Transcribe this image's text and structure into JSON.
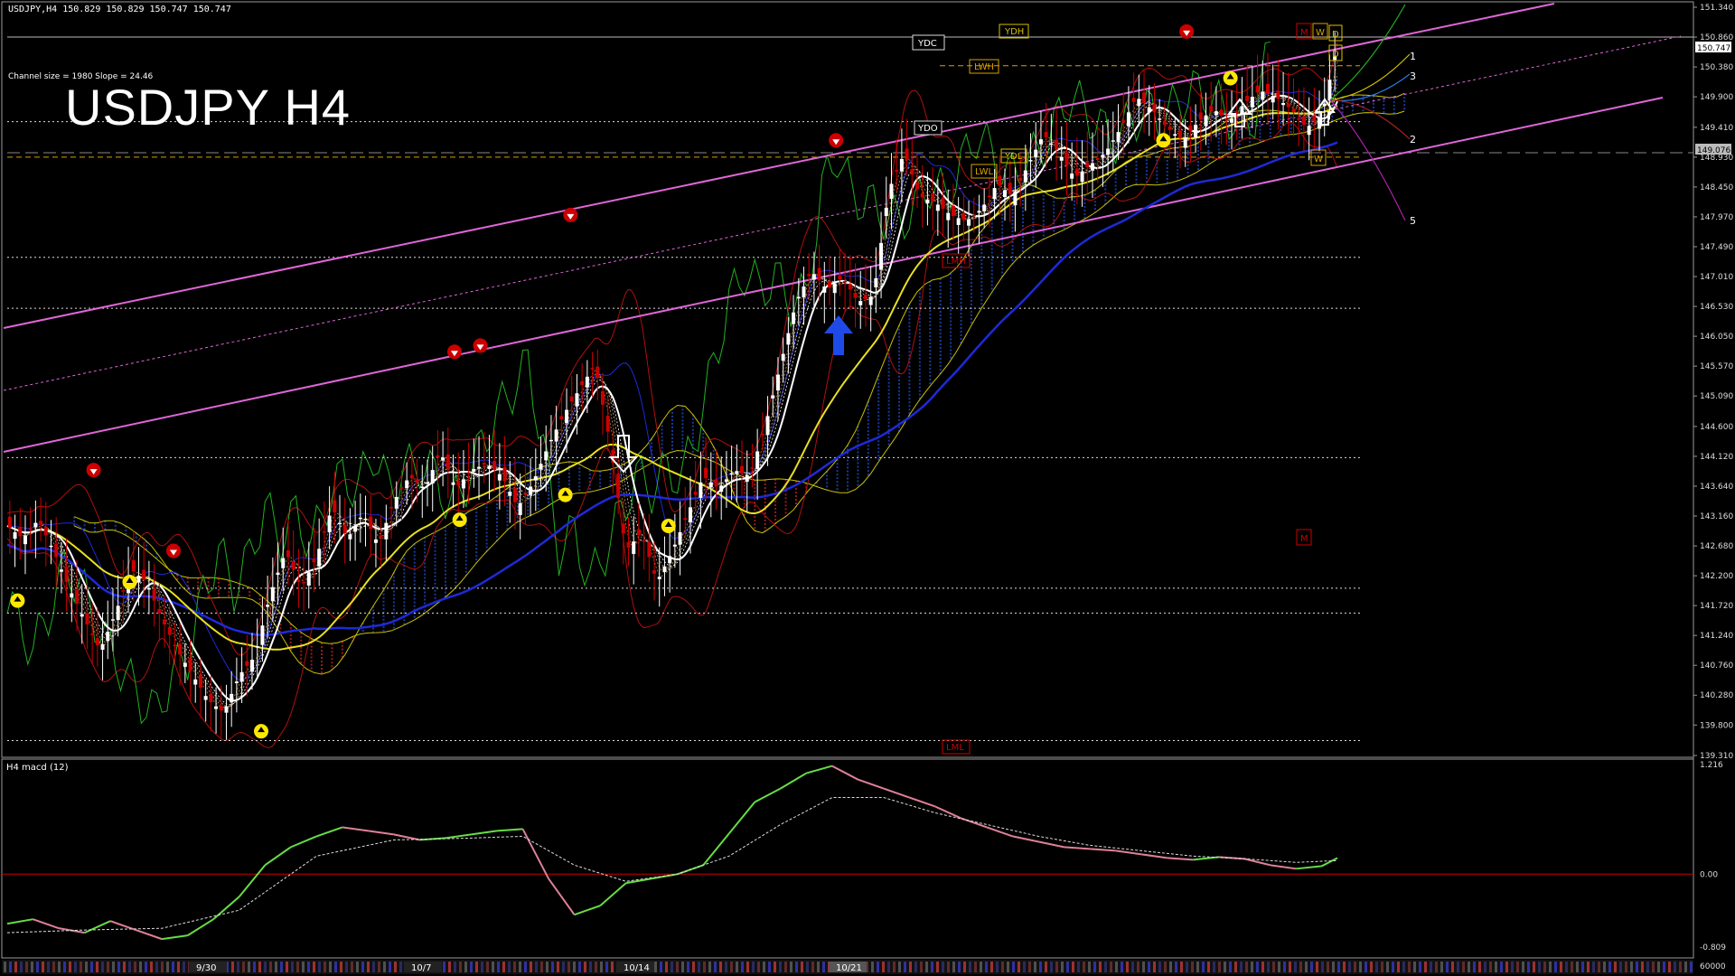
{
  "header": {
    "symbol_line": "USDJPY,H4  150.829 150.829 150.747 150.747",
    "channel_info": "Channel size = 1980 Slope = 24.46",
    "big_title": "USDJPY H4"
  },
  "macd_header": "H4  macd (12)",
  "colors": {
    "background": "#000000",
    "bull_candle": "#ffffff",
    "bear_candle": "#cc0000",
    "channel": "#e066d8",
    "ma_white": "#ffffff",
    "ma_yellow": "#e8e020",
    "ma_blue": "#1e2ad8",
    "bollinger": "#b01010",
    "chikou": "#22b022",
    "cloud_bull": "#1a3a9a",
    "cloud_bear": "#9a1a1a",
    "macd_up": "#66dd44",
    "macd_down": "#e08098",
    "zero_line": "#cc0000"
  },
  "price_axis_labels": [
    "151.340",
    "150.860",
    "150.380",
    "149.900",
    "149.410",
    "148.930",
    "148.450",
    "147.970",
    "147.490",
    "147.010",
    "146.530",
    "146.050",
    "145.570",
    "145.090",
    "144.600",
    "144.120",
    "143.640",
    "143.160",
    "142.680",
    "142.200",
    "141.720",
    "141.240",
    "140.760",
    "140.280",
    "139.800",
    "139.310"
  ],
  "price_tags": {
    "current": "150.747",
    "ydc_value": "150.747",
    "ydo_value": "149.076"
  },
  "level_labels": {
    "ydh": "YDH",
    "ydc": "YDC",
    "lwh": "LWH",
    "ydo": "YDO",
    "ydl": "YDL",
    "lwl": "LWL",
    "lmh": "LMH",
    "lml": "LML",
    "m_top": "M",
    "w_top": "W",
    "d_top": "D",
    "d_second": "D",
    "w_low": "W",
    "m_mid": "M"
  },
  "projection_labels": [
    "1",
    "3",
    "2",
    "5"
  ],
  "macd_axis_labels": [
    "1.216",
    "0.00",
    "-0.809",
    "60000"
  ],
  "date_labels": [
    "9/30",
    "10/7",
    "10/14",
    "10/21"
  ],
  "chart_data": {
    "type": "line",
    "title": "USDJPY H4",
    "y_axis_range": [
      139.31,
      151.34
    ],
    "series": [
      {
        "name": "USDJPY",
        "type": "candlestick-approx-close",
        "points": [
          [
            0,
            143.0
          ],
          [
            6,
            142.8
          ],
          [
            12,
            143.1
          ],
          [
            18,
            142.6
          ],
          [
            24,
            142.0
          ],
          [
            30,
            141.5
          ],
          [
            36,
            141.0
          ],
          [
            42,
            141.6
          ],
          [
            48,
            142.3
          ],
          [
            54,
            142.1
          ],
          [
            60,
            141.5
          ],
          [
            66,
            141.0
          ],
          [
            72,
            140.6
          ],
          [
            78,
            140.2
          ],
          [
            84,
            140.0
          ],
          [
            90,
            140.6
          ],
          [
            96,
            140.9
          ],
          [
            102,
            141.9
          ],
          [
            108,
            142.6
          ],
          [
            114,
            142.0
          ],
          [
            120,
            142.5
          ],
          [
            126,
            143.3
          ],
          [
            132,
            142.8
          ],
          [
            138,
            143.2
          ],
          [
            144,
            142.7
          ],
          [
            150,
            143.4
          ],
          [
            156,
            143.8
          ],
          [
            162,
            143.6
          ],
          [
            168,
            144.2
          ],
          [
            174,
            143.6
          ],
          [
            180,
            143.9
          ],
          [
            186,
            144.0
          ],
          [
            192,
            143.8
          ],
          [
            198,
            143.3
          ],
          [
            204,
            143.7
          ],
          [
            210,
            144.3
          ],
          [
            216,
            144.8
          ],
          [
            222,
            145.2
          ],
          [
            228,
            145.6
          ],
          [
            234,
            144.3
          ],
          [
            240,
            142.6
          ],
          [
            246,
            142.9
          ],
          [
            252,
            142.1
          ],
          [
            258,
            142.6
          ],
          [
            264,
            143.2
          ],
          [
            270,
            143.8
          ],
          [
            276,
            143.6
          ],
          [
            282,
            143.9
          ],
          [
            288,
            143.8
          ],
          [
            294,
            144.6
          ],
          [
            300,
            145.6
          ],
          [
            306,
            146.6
          ],
          [
            312,
            147.1
          ],
          [
            318,
            146.8
          ],
          [
            324,
            147.0
          ],
          [
            330,
            146.6
          ],
          [
            336,
            146.7
          ],
          [
            342,
            148.4
          ],
          [
            348,
            149.0
          ],
          [
            354,
            148.3
          ],
          [
            360,
            148.2
          ],
          [
            366,
            148.0
          ],
          [
            372,
            147.9
          ],
          [
            378,
            148.1
          ],
          [
            384,
            148.5
          ],
          [
            390,
            148.3
          ],
          [
            396,
            148.8
          ],
          [
            402,
            149.3
          ],
          [
            408,
            149.0
          ],
          [
            414,
            148.6
          ],
          [
            420,
            148.8
          ],
          [
            426,
            149.0
          ],
          [
            432,
            149.4
          ],
          [
            438,
            149.9
          ],
          [
            444,
            149.7
          ],
          [
            450,
            149.4
          ],
          [
            456,
            149.2
          ],
          [
            462,
            149.5
          ],
          [
            468,
            149.7
          ],
          [
            474,
            149.5
          ],
          [
            480,
            149.8
          ],
          [
            486,
            150.0
          ],
          [
            492,
            149.9
          ],
          [
            498,
            149.7
          ],
          [
            504,
            149.4
          ],
          [
            510,
            149.6
          ],
          [
            516,
            150.75
          ]
        ]
      }
    ],
    "macd_range": [
      -0.809,
      1.216
    ],
    "macd": [
      [
        0,
        -0.55
      ],
      [
        10,
        -0.5
      ],
      [
        20,
        -0.6
      ],
      [
        30,
        -0.65
      ],
      [
        40,
        -0.52
      ],
      [
        50,
        -0.62
      ],
      [
        60,
        -0.72
      ],
      [
        70,
        -0.68
      ],
      [
        80,
        -0.5
      ],
      [
        90,
        -0.25
      ],
      [
        100,
        0.1
      ],
      [
        110,
        0.3
      ],
      [
        120,
        0.42
      ],
      [
        130,
        0.52
      ],
      [
        140,
        0.48
      ],
      [
        150,
        0.44
      ],
      [
        160,
        0.38
      ],
      [
        170,
        0.4
      ],
      [
        180,
        0.44
      ],
      [
        190,
        0.48
      ],
      [
        200,
        0.5
      ],
      [
        210,
        -0.05
      ],
      [
        220,
        -0.45
      ],
      [
        230,
        -0.35
      ],
      [
        240,
        -0.1
      ],
      [
        250,
        -0.05
      ],
      [
        260,
        0.0
      ],
      [
        270,
        0.1
      ],
      [
        280,
        0.45
      ],
      [
        290,
        0.8
      ],
      [
        300,
        0.95
      ],
      [
        310,
        1.12
      ],
      [
        320,
        1.2
      ],
      [
        330,
        1.05
      ],
      [
        340,
        0.95
      ],
      [
        350,
        0.85
      ],
      [
        360,
        0.75
      ],
      [
        370,
        0.62
      ],
      [
        380,
        0.52
      ],
      [
        390,
        0.42
      ],
      [
        400,
        0.36
      ],
      [
        410,
        0.3
      ],
      [
        420,
        0.28
      ],
      [
        430,
        0.26
      ],
      [
        440,
        0.22
      ],
      [
        450,
        0.18
      ],
      [
        460,
        0.16
      ],
      [
        470,
        0.19
      ],
      [
        480,
        0.17
      ],
      [
        490,
        0.1
      ],
      [
        500,
        0.06
      ],
      [
        510,
        0.09
      ],
      [
        516,
        0.18
      ]
    ],
    "macd_signal": [
      [
        0,
        -0.65
      ],
      [
        30,
        -0.62
      ],
      [
        60,
        -0.6
      ],
      [
        90,
        -0.4
      ],
      [
        120,
        0.2
      ],
      [
        150,
        0.38
      ],
      [
        180,
        0.4
      ],
      [
        200,
        0.42
      ],
      [
        220,
        0.1
      ],
      [
        240,
        -0.08
      ],
      [
        260,
        0.0
      ],
      [
        280,
        0.2
      ],
      [
        300,
        0.55
      ],
      [
        320,
        0.85
      ],
      [
        340,
        0.85
      ],
      [
        360,
        0.68
      ],
      [
        380,
        0.55
      ],
      [
        400,
        0.42
      ],
      [
        420,
        0.32
      ],
      [
        440,
        0.26
      ],
      [
        460,
        0.2
      ],
      [
        480,
        0.17
      ],
      [
        500,
        0.13
      ],
      [
        516,
        0.15
      ]
    ]
  }
}
